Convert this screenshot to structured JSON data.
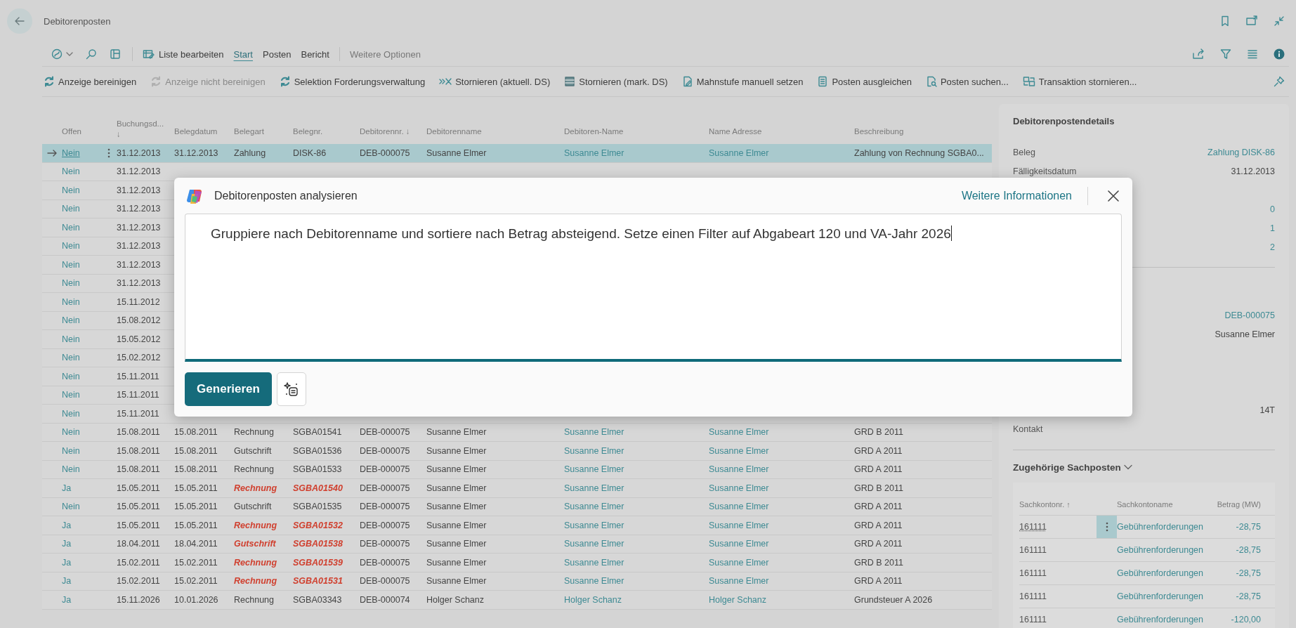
{
  "page": {
    "title": "Debitorenposten"
  },
  "action_bar": {
    "edit_list": "Liste bearbeiten",
    "more": "Weitere Optionen",
    "tabs": [
      {
        "label": "Start",
        "selected": true
      },
      {
        "label": "Posten",
        "selected": false
      },
      {
        "label": "Bericht",
        "selected": false
      }
    ]
  },
  "actions": [
    {
      "label": "Anzeige bereinigen",
      "disabled": false
    },
    {
      "label": "Anzeige nicht bereinigen",
      "disabled": true
    },
    {
      "label": "Selektion Forderungsverwaltung",
      "disabled": false
    },
    {
      "label": "Stornieren (aktuell. DS)",
      "disabled": false
    },
    {
      "label": "Stornieren (mark. DS)",
      "disabled": false
    },
    {
      "label": "Mahnstufe manuell setzen",
      "disabled": false
    },
    {
      "label": "Posten ausgleichen",
      "disabled": false
    },
    {
      "label": "Posten suchen...",
      "disabled": false
    },
    {
      "label": "Transaktion stornieren...",
      "disabled": false
    }
  ],
  "list": {
    "columns": [
      {
        "label": "Offen",
        "kind": "link"
      },
      {
        "label": "Buchungsd...",
        "kind": "text",
        "sort_mark": "↓"
      },
      {
        "label": "Belegdatum",
        "kind": "text"
      },
      {
        "label": "Belegart",
        "kind": "doc"
      },
      {
        "label": "Belegnr.",
        "kind": "doc"
      },
      {
        "label": "Debitorennr. ↓",
        "kind": "text"
      },
      {
        "label": "Debitorenname",
        "kind": "text"
      },
      {
        "label": "Debitoren-Name",
        "kind": "link"
      },
      {
        "label": "Name Adresse",
        "kind": "link"
      },
      {
        "label": "Beschreibung",
        "kind": "text"
      }
    ],
    "rows": [
      {
        "selected": true,
        "overdue": false,
        "cells": [
          "Nein",
          "31.12.2013",
          "31.12.2013",
          "Zahlung",
          "DISK-86",
          "DEB-000075",
          "Susanne Elmer",
          "Susanne Elmer",
          "Susanne Elmer",
          "Zahlung von Rechnung SGBA0..."
        ]
      },
      {
        "selected": false,
        "cells": [
          "Nein",
          "31.12.2013"
        ]
      },
      {
        "selected": false,
        "cells": [
          "Nein",
          "31.12.2013"
        ]
      },
      {
        "selected": false,
        "cells": [
          "Nein",
          "31.12.2013"
        ]
      },
      {
        "selected": false,
        "cells": [
          "Nein",
          "31.12.2013"
        ]
      },
      {
        "selected": false,
        "cells": [
          "Nein",
          "31.12.2013"
        ]
      },
      {
        "selected": false,
        "cells": [
          "Nein",
          "31.12.2013"
        ]
      },
      {
        "selected": false,
        "cells": [
          "Nein",
          "31.12.2013"
        ]
      },
      {
        "selected": false,
        "cells": [
          "Nein",
          "15.11.2012"
        ]
      },
      {
        "selected": false,
        "cells": [
          "Nein",
          "15.08.2012"
        ]
      },
      {
        "selected": false,
        "cells": [
          "Nein",
          "15.05.2012"
        ]
      },
      {
        "selected": false,
        "cells": [
          "Nein",
          "15.02.2012"
        ]
      },
      {
        "selected": false,
        "cells": [
          "Nein",
          "15.11.2011"
        ]
      },
      {
        "selected": false,
        "cells": [
          "Nein",
          "15.11.2011"
        ]
      },
      {
        "selected": false,
        "cells": [
          "Nein",
          "15.11.2011"
        ]
      },
      {
        "selected": false,
        "overdue": false,
        "cells": [
          "Nein",
          "15.08.2011",
          "15.08.2011",
          "Rechnung",
          "SGBA01541",
          "DEB-000075",
          "Susanne Elmer",
          "Susanne Elmer",
          "Susanne Elmer",
          "GRD B 2011"
        ]
      },
      {
        "selected": false,
        "overdue": false,
        "cells": [
          "Nein",
          "15.08.2011",
          "15.08.2011",
          "Gutschrift",
          "SGBA01536",
          "DEB-000075",
          "Susanne Elmer",
          "Susanne Elmer",
          "Susanne Elmer",
          "GRD A 2011"
        ]
      },
      {
        "selected": false,
        "overdue": false,
        "cells": [
          "Nein",
          "15.08.2011",
          "15.08.2011",
          "Rechnung",
          "SGBA01533",
          "DEB-000075",
          "Susanne Elmer",
          "Susanne Elmer",
          "Susanne Elmer",
          "GRD A 2011"
        ]
      },
      {
        "selected": false,
        "overdue": true,
        "cells": [
          "Ja",
          "15.05.2011",
          "15.05.2011",
          "Rechnung",
          "SGBA01540",
          "DEB-000075",
          "Susanne Elmer",
          "Susanne Elmer",
          "Susanne Elmer",
          "GRD B 2011"
        ]
      },
      {
        "selected": false,
        "overdue": false,
        "cells": [
          "Nein",
          "15.05.2011",
          "15.05.2011",
          "Gutschrift",
          "SGBA01535",
          "DEB-000075",
          "Susanne Elmer",
          "Susanne Elmer",
          "Susanne Elmer",
          "GRD A 2011"
        ]
      },
      {
        "selected": false,
        "overdue": true,
        "cells": [
          "Ja",
          "15.05.2011",
          "15.05.2011",
          "Rechnung",
          "SGBA01532",
          "DEB-000075",
          "Susanne Elmer",
          "Susanne Elmer",
          "Susanne Elmer",
          "GRD A 2011"
        ]
      },
      {
        "selected": false,
        "overdue": true,
        "cells": [
          "Ja",
          "18.04.2011",
          "18.04.2011",
          "Gutschrift",
          "SGBA01538",
          "DEB-000075",
          "Susanne Elmer",
          "Susanne Elmer",
          "Susanne Elmer",
          "GRD A 2011"
        ]
      },
      {
        "selected": false,
        "overdue": true,
        "cells": [
          "Ja",
          "15.02.2011",
          "15.02.2011",
          "Rechnung",
          "SGBA01539",
          "DEB-000075",
          "Susanne Elmer",
          "Susanne Elmer",
          "Susanne Elmer",
          "GRD B 2011"
        ]
      },
      {
        "selected": false,
        "overdue": true,
        "cells": [
          "Ja",
          "15.02.2011",
          "15.02.2011",
          "Rechnung",
          "SGBA01531",
          "DEB-000075",
          "Susanne Elmer",
          "Susanne Elmer",
          "Susanne Elmer",
          "GRD A 2011"
        ]
      },
      {
        "selected": false,
        "overdue": false,
        "cells": [
          "Ja",
          "15.11.2026",
          "10.01.2026",
          "Rechnung",
          "SGBA03343",
          "DEB-000074",
          "Holger Schanz",
          "Holger Schanz",
          "Holger Schanz",
          "Grundsteuer A 2026"
        ]
      }
    ]
  },
  "factbox": {
    "title": "Debitorenpostendetails",
    "fields": [
      {
        "label": "Beleg",
        "value": "Zahlung DISK-86",
        "link": true
      },
      {
        "label": "Fälligkeitsdatum",
        "value": "31.12.2013",
        "link": false
      },
      {
        "value": "0",
        "link": true
      },
      {
        "value": "1",
        "link": true
      },
      {
        "value": "2",
        "link": true
      }
    ],
    "fields_2": [
      {
        "value": "DEB-000075",
        "link": true
      },
      {
        "value": "Susanne Elmer",
        "link": false
      },
      {
        "value": "14T",
        "link": false
      },
      {
        "label": "Kontakt"
      }
    ],
    "related": {
      "title": "Zugehörige Sachposten",
      "columns": [
        "Sachkontonr. ↑",
        "Sachkontoname",
        "Betrag (MW)"
      ],
      "rows": [
        {
          "selected": true,
          "cells": [
            "161111",
            "Gebührenforderungen",
            "-28,75"
          ]
        },
        {
          "selected": false,
          "cells": [
            "161111",
            "Gebührenforderungen",
            "-28,75"
          ]
        },
        {
          "selected": false,
          "cells": [
            "161111",
            "Gebührenforderungen",
            "-28,75"
          ]
        },
        {
          "selected": false,
          "cells": [
            "161111",
            "Gebührenforderungen",
            "-28,75"
          ]
        },
        {
          "selected": false,
          "cells": [
            "161111",
            "Gebührenforderungen",
            "-120,00"
          ]
        }
      ]
    }
  },
  "dialog": {
    "title": "Debitorenposten analysieren",
    "link": "Weitere Informationen",
    "prompt": "Gruppiere nach Debitorenname und sortiere nach Betrag absteigend. Setze einen Filter auf Abgabeart 120 und VA-Jahr 2026",
    "button": "Generieren"
  }
}
